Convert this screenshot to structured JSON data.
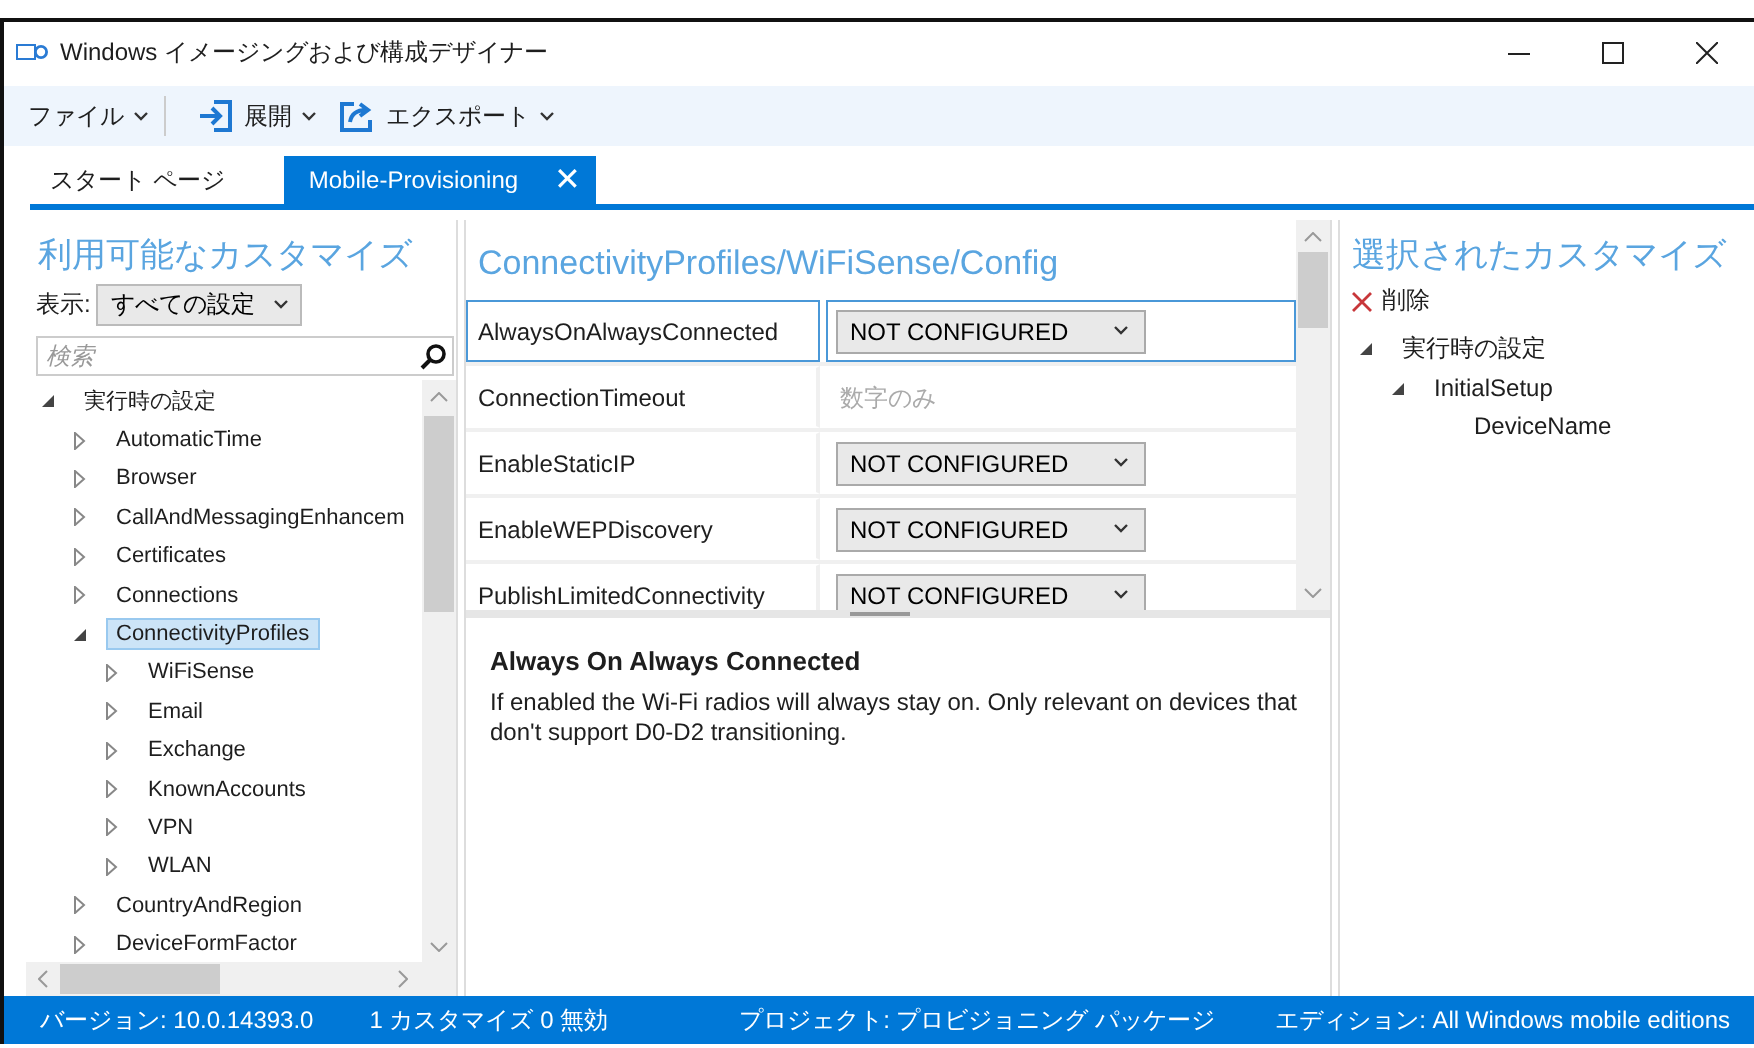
{
  "window": {
    "title": "Windows イメージングおよび構成デザイナー"
  },
  "toolbar": [
    {
      "label": "ファイル",
      "kind": "menu"
    },
    {
      "label": "展開",
      "kind": "deploy"
    },
    {
      "label": "エクスポート",
      "kind": "export"
    }
  ],
  "tabs": [
    {
      "label": "スタート ページ",
      "selected": false
    },
    {
      "label": "Mobile-Provisioning",
      "selected": true,
      "close": "✕"
    }
  ],
  "available": {
    "title": "利用可能なカスタマイズ",
    "view_label": "表示:",
    "view_value": "すべての設定",
    "search": {
      "placeholder": "検索"
    },
    "tree": [
      {
        "label": "実行時の設定",
        "expanded": true,
        "selected": false,
        "children": [
          {
            "label": "AutomaticTime",
            "expanded": false,
            "selected": false
          },
          {
            "label": "Browser",
            "expanded": false,
            "selected": false
          },
          {
            "label": "CallAndMessagingEnhancem",
            "expanded": false,
            "selected": false
          },
          {
            "label": "Certificates",
            "expanded": false,
            "selected": false
          },
          {
            "label": "Connections",
            "expanded": false,
            "selected": false
          },
          {
            "label": "ConnectivityProfiles",
            "expanded": true,
            "selected": true,
            "children": [
              {
                "label": "WiFiSense",
                "expanded": false,
                "selected": false
              },
              {
                "label": "Email",
                "expanded": false,
                "selected": false
              },
              {
                "label": "Exchange",
                "expanded": false,
                "selected": false
              },
              {
                "label": "KnownAccounts",
                "expanded": false,
                "selected": false
              },
              {
                "label": "VPN",
                "expanded": false,
                "selected": false
              },
              {
                "label": "WLAN",
                "expanded": false,
                "selected": false
              }
            ]
          },
          {
            "label": "CountryAndRegion",
            "expanded": false,
            "selected": false
          },
          {
            "label": "DeviceFormFactor",
            "expanded": false,
            "selected": false
          }
        ]
      }
    ]
  },
  "settings": {
    "title": "ConnectivityProfiles/WiFiSense/Config",
    "rows": [
      {
        "name": "AlwaysOnAlwaysConnected",
        "kind": "dropdown",
        "value": "NOT CONFIGURED",
        "selected": true
      },
      {
        "name": "ConnectionTimeout",
        "kind": "text",
        "placeholder": "数字のみ",
        "selected": false
      },
      {
        "name": "EnableStaticIP",
        "kind": "dropdown",
        "value": "NOT CONFIGURED",
        "selected": false
      },
      {
        "name": "EnableWEPDiscovery",
        "kind": "dropdown",
        "value": "NOT CONFIGURED",
        "selected": false
      },
      {
        "name": "PublishLimitedConnectivity",
        "kind": "dropdown",
        "value": "NOT CONFIGURED",
        "selected": false
      }
    ],
    "description": {
      "title": "Always On Always Connected",
      "text": "If enabled the Wi-Fi radios will always stay on. Only relevant on devices that don't support D0-D2 transitioning."
    }
  },
  "selected_panel": {
    "title": "選択されたカスタマイズ",
    "remove": "削除",
    "tree": [
      {
        "label": "実行時の設定",
        "expanded": true,
        "children": [
          {
            "label": "InitialSetup",
            "expanded": true,
            "children": [
              {
                "label": "DeviceName"
              }
            ]
          }
        ]
      }
    ]
  },
  "status_bar": {
    "version": "バージョン: 10.0.14393.0",
    "counts": "1 カスタマイズ 0 無効",
    "project": "プロジェクト: プロビジョニング パッケージ",
    "edition": "エディション: All Windows mobile editions"
  }
}
